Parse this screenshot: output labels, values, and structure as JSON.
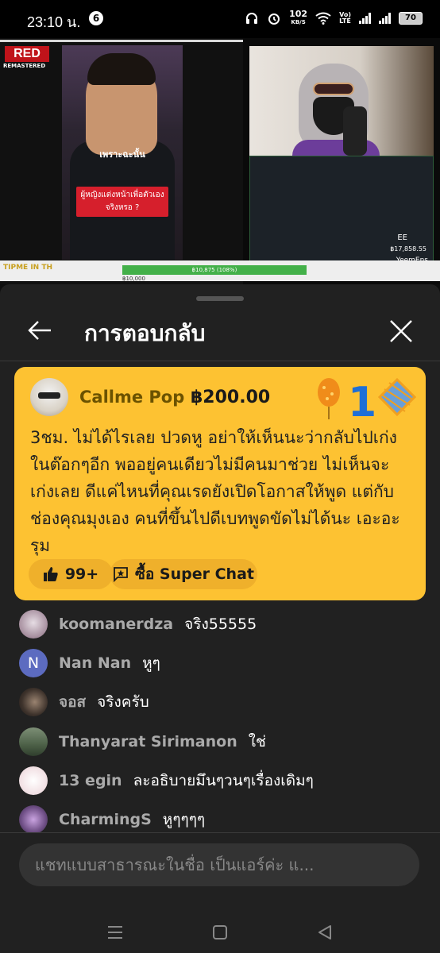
{
  "status_bar": {
    "time": "23:10 น.",
    "notification_count": "6",
    "net_speed_value": "102",
    "net_speed_unit": "KB/S",
    "volte_top": "Vo)",
    "volte_bottom": "LTE",
    "battery": "70"
  },
  "video": {
    "logo": "RED",
    "logo_sub": "REMASTERED",
    "caption_1": "เพราะฉะนั้น",
    "caption_2": "ผู้หญิงแต่งหน้าเพื่อตัวเอง จริงหรอ ?",
    "overlay_ee": "EE",
    "overlay_amount": "฿17,858.55",
    "overlay_name": "YeemEns",
    "progress_label": "฿10,875 (108%)",
    "progress_sub": "฿10,000",
    "tip_text": "TIPME IN TH"
  },
  "header": {
    "title": "การตอบกลับ"
  },
  "superchat": {
    "author": "Callme Pop",
    "amount": "฿200.00",
    "badge_number": "1",
    "message": "3ชม. ไม่ได้ไรเลย ปวดหู อย่าให้เห็นนะว่ากลับไปเก่งในต๊อกๆอีก พออยู่คนเดียวไม่มีคนมาช่วย ไม่เห็นจะเก่งเลย ดีแค่ไหนที่คุณเรดยังเปิดโอกาสให้พูด แต่กับช่องคุณมุงเอง คนที่ขึ้นไปดีเบทพูดขัดไม่ได้นะ เอะอะรุม",
    "likes": "99+",
    "buy_label": "ซื้อ Super Chat"
  },
  "chat": [
    {
      "author": "koomanerdza",
      "message": "จริง55555",
      "avatar": "photo-avatar"
    },
    {
      "author": "Nan Nan",
      "message": "หูๆ",
      "avatar_letter": "N"
    },
    {
      "author": "จอส",
      "message": "จริงครับ",
      "avatar": "photo-avatar"
    },
    {
      "author": "Thanyarat Sirimanon",
      "message": "ใช่",
      "avatar": "photo-avatar"
    },
    {
      "author": "13 egin",
      "message": "ละอธิบายมึนๆวนๆเรื่องเดิมๆ",
      "avatar": "photo-avatar"
    },
    {
      "author": "CharmingS",
      "message": "หูๆๆๆๆ",
      "avatar": "photo-avatar"
    }
  ],
  "input": {
    "placeholder": "แชทแบบสาธารณะในชื่อ เป็นแอร์ค่ะ แ..."
  },
  "colors": {
    "superchat_bg": "#fdc232",
    "sheet_bg": "#212121",
    "nan_avatar": "#5c6bc0"
  }
}
